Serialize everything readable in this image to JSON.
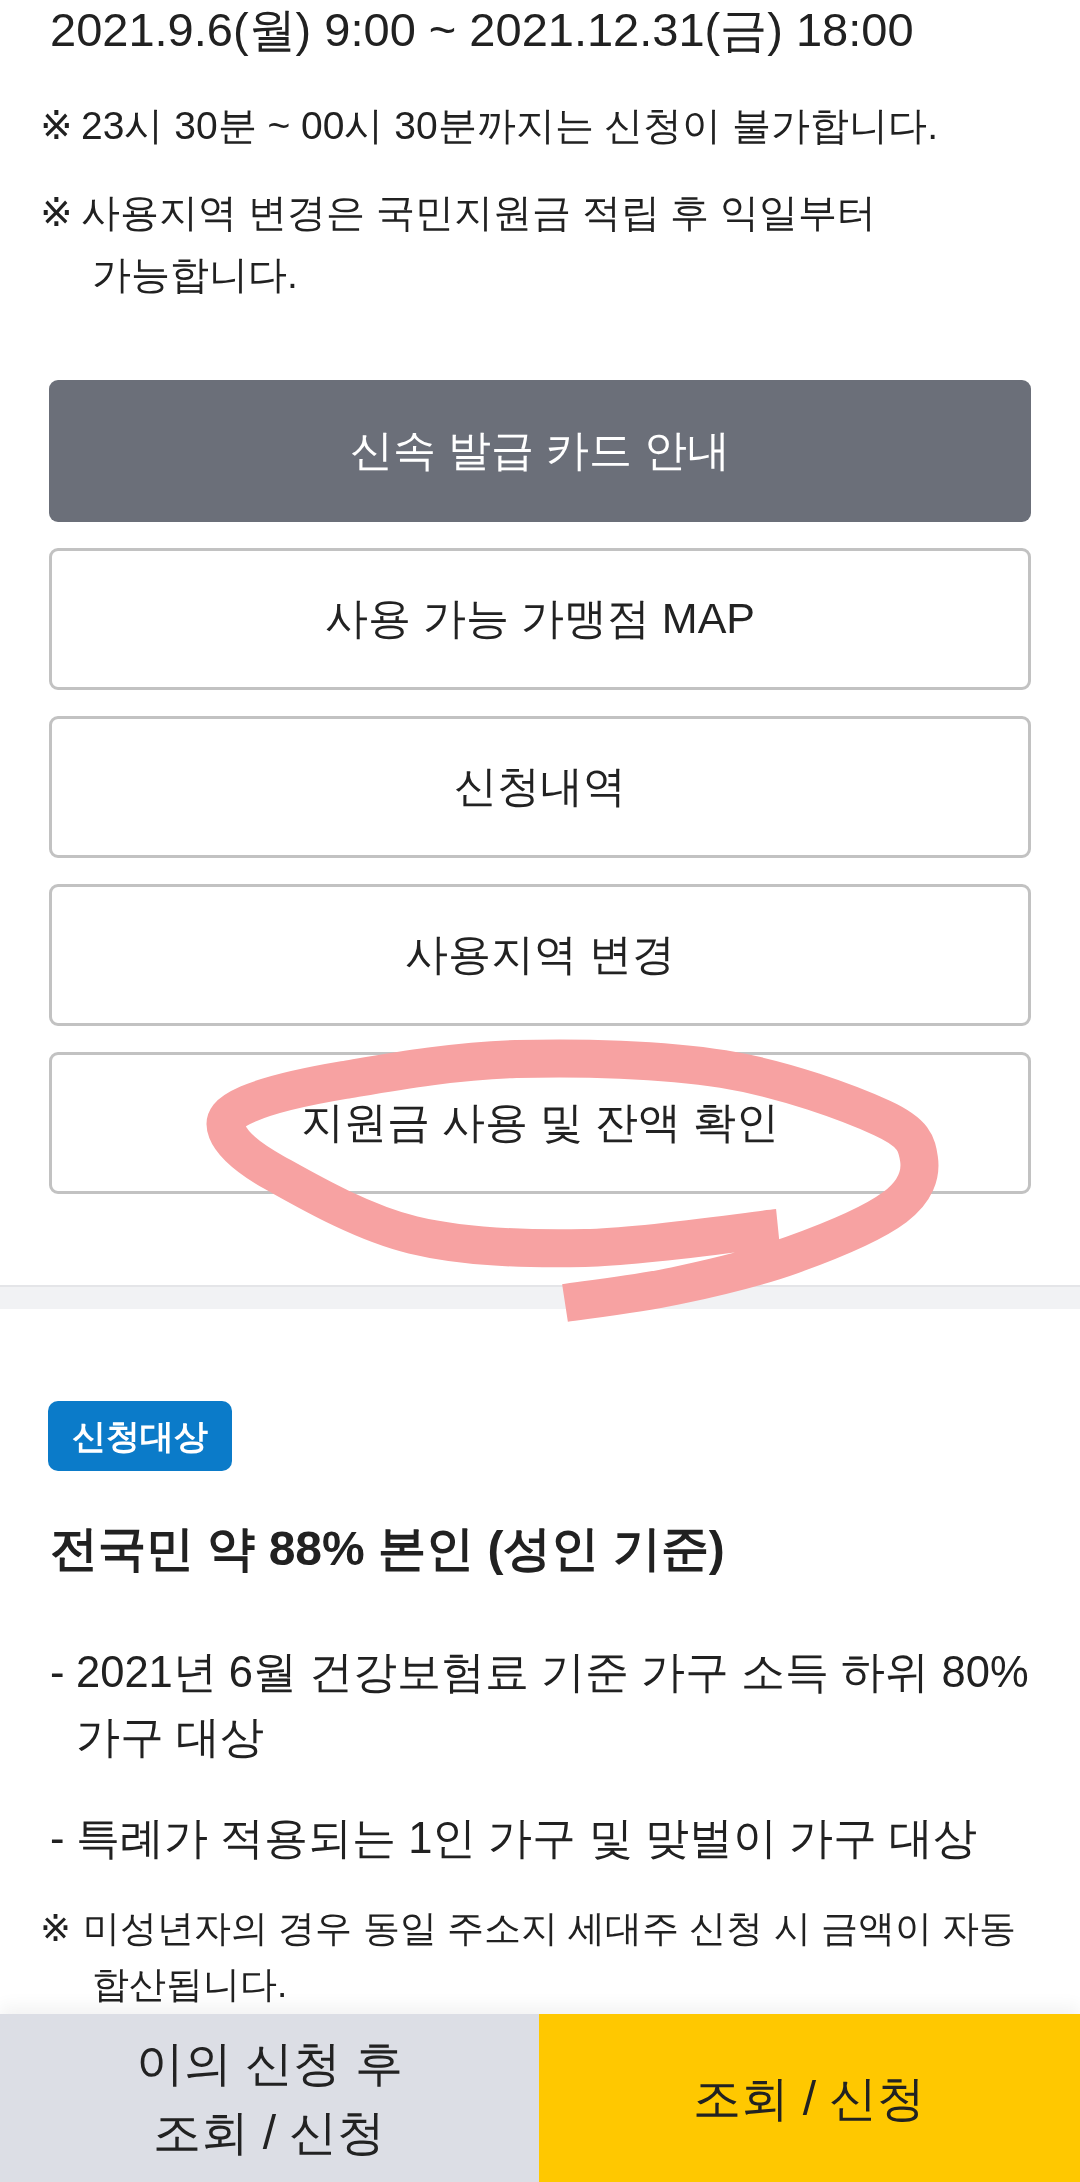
{
  "period": "2021.9.6(월) 9:00 ~ 2021.12.31(금) 18:00",
  "notes": [
    {
      "mark": "※",
      "text": "23시 30분 ~ 00시 30분까지는 신청이 불가합니다."
    },
    {
      "mark": "※",
      "text": "사용지역 변경은 국민지원금 적립 후 익일부터 가능합니다."
    }
  ],
  "buttons": [
    {
      "label": "신속 발급 카드 안내",
      "kind": "filled",
      "circled": false
    },
    {
      "label": "사용 가능 가맹점 MAP",
      "kind": "outline",
      "circled": false
    },
    {
      "label": "신청내역",
      "kind": "outline",
      "circled": false
    },
    {
      "label": "사용지역 변경",
      "kind": "outline",
      "circled": false
    },
    {
      "label": "지원금 사용 및 잔액 확인",
      "kind": "outline",
      "circled": true
    }
  ],
  "eligibility": {
    "badge": "신청대상",
    "heading": "전국민 약 88% 본인 (성인 기준)",
    "criteria": [
      {
        "mark": "-",
        "text": "2021년 6월 건강보험료 기준 가구 소득 하위 80% 가구 대상"
      },
      {
        "mark": "-",
        "text": "특례가 적용되는 1인 가구 및 맞벌이 가구 대상"
      }
    ],
    "note": {
      "mark": "※",
      "text": "미성년자의 경우 동일 주소지 세대주 신청 시 금액이 자동 합산됩니다."
    }
  },
  "bottom_bar": [
    {
      "label": "이의 신청 후 조회 / 신청",
      "kind": "secondary"
    },
    {
      "label": "조회 / 신청",
      "kind": "primary"
    }
  ]
}
